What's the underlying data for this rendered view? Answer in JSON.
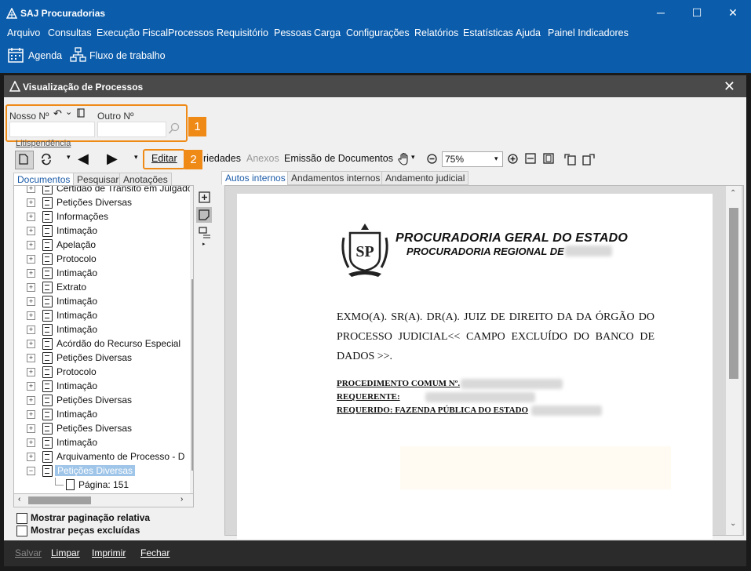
{
  "app": {
    "title": "SAJ Procuradorias"
  },
  "menu": [
    "Arquivo",
    "Consultas",
    "Execução Fiscal",
    "Processos",
    "Requisitório",
    "Pessoas",
    "Carga",
    "Configurações",
    "Relatórios",
    "Estatísticas",
    "Ajuda",
    "Painel Indicadores"
  ],
  "toolbar": {
    "agenda": "Agenda",
    "fluxo": "Fluxo de trabalho"
  },
  "dialog": {
    "title": "Visualização de Processos",
    "nosso_label": "Nosso Nº",
    "outro_label": "Outro Nº",
    "litis": "Litispendência",
    "badge1": "1",
    "badge2": "2",
    "editar": "Editar",
    "propriedades": "riedades",
    "anexos": "Anexos",
    "emissao": "Emissão de Documentos",
    "zoom": "75%"
  },
  "left_tabs": [
    "Documentos",
    "Pesquisar",
    "Anotações"
  ],
  "right_tabs": [
    "Autos internos",
    "Andamentos internos",
    "Andamento judicial"
  ],
  "tree": {
    "items": [
      "Certidão de Trânsito em Julgado",
      "Petições Diversas",
      "Informações",
      "Intimação",
      "Apelação",
      "Protocolo",
      "Intimação",
      "Extrato",
      "Intimação",
      "Intimação",
      "Intimação",
      "Acórdão do Recurso Especial",
      "Petições Diversas",
      "Protocolo",
      "Intimação",
      "Petições Diversas",
      "Intimação",
      "Petições Diversas",
      "Intimação",
      "Arquivamento de Processo - D",
      "Petições Diversas"
    ],
    "child": "Página: 151"
  },
  "checkboxes": {
    "relativa": "Mostrar paginação relativa",
    "excluidas": "Mostrar peças excluídas"
  },
  "bottom": {
    "salvar": "Salvar",
    "limpar": "Limpar",
    "imprimir": "Imprimir",
    "fechar": "Fechar"
  },
  "document": {
    "org1": "PROCURADORIA GERAL DO ESTADO",
    "org2": "PROCURADORIA REGIONAL DE",
    "seal": "SP",
    "greeting": "EXMO(A). SR(A). DR(A). JUIZ DE DIREITO DA  DA ÓRGÃO DO PROCESSO JUDICIAL<< CAMPO EXCLUÍDO DO BANCO DE DADOS >>.",
    "proc": "PROCEDIMENTO COMUM Nº.",
    "req": "REQUERENTE:",
    "reqdo": "REQUERIDO: FAZENDA PÚBLICA DO ESTADO"
  }
}
